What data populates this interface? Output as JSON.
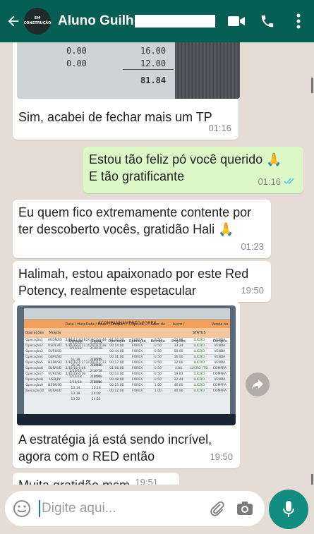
{
  "header": {
    "contact_name": "Aluno Guilh",
    "avatar_line1": "EM",
    "avatar_line2": "CONSTRUÇÃO"
  },
  "colors": {
    "header_bg": "#075e54",
    "chat_bg": "#e5ddd5",
    "outgoing_bubble": "#dcf8c6",
    "accent": "#128c7e",
    "read_ticks": "#4fc3f7"
  },
  "image1": {
    "values": [
      "0.00",
      "0.00",
      "16.00",
      "12.00",
      "81.84"
    ]
  },
  "messages": [
    {
      "text": "Sim, acabei de fechar mais um TP",
      "time": "01:16"
    },
    {
      "line1": "Estou tão feliz pó você querido 🙏",
      "line2": "E tão gratificante",
      "time": "01:16"
    },
    {
      "line1": "Eu quem fico extremamente contente por",
      "line2": "ter descoberto vocês,  gratidão Hali 🙏",
      "time": "01:23"
    },
    {
      "line1": "Halimah,  estou apaixonado por este Red",
      "line2": "Potency,  realmente espetacular",
      "time": "19:50"
    },
    {
      "line1": "A estratégia já está sendo incrível,",
      "line2": "agora com o RED então",
      "time": "19:50"
    },
    {
      "text": "Muita gratidão msm",
      "time": "19:51"
    }
  ],
  "spreadsheet": {
    "title": "ACOMPANHAMENTO FOREX",
    "headers": [
      "Operações",
      "Moeda",
      "Data / Hora Entrada",
      "Data / Hora Saída",
      "Tempo Operação",
      "Tipo de Operação",
      "Valor de Entrada",
      "Lucro / Prejuízo",
      "STATUS",
      "Venda ou Compra"
    ],
    "rows": [
      [
        "Operação1",
        "AUDNZD",
        "2/18/17 6:48",
        "2/18/17 6:49",
        "01:06:29",
        "FOREX",
        "0.50",
        "25.88",
        "LUCRO",
        "VENDA"
      ],
      [
        "Operação2",
        "USDCAD",
        "5/16/18 0:11",
        "1/10/18 0:28",
        "00:14:00",
        "FOREX",
        "0.50",
        "33.34",
        "LUCRO",
        "VENDA"
      ],
      [
        "Operação3",
        "EURUSD",
        "2/10/18 11:38",
        "2/10/18 12:24",
        "00:44:00",
        "FOREX",
        "0.50",
        "50.00",
        "LUCRO",
        "VENDA"
      ],
      [
        "Operação4",
        "GBPUSD",
        "2/10/18 15:16",
        "2/10/18 15:46",
        "00:31:00",
        "FOREX",
        "0.50",
        "16.00",
        "LUCRO",
        "VENDA"
      ],
      [
        "Operação5",
        "NZDUSD",
        "2/10/18 6:27",
        "2/10/18 1:23",
        "00:17:00",
        "FOREX",
        "0.50",
        "12.00",
        "LUCRO",
        "VENDA"
      ],
      [
        "Operação6",
        "EURAUD",
        "2/10/18 6:46",
        "2/10/18 11:01",
        "01:06:00",
        "FOREX",
        "0.50",
        "4.84",
        "LUCRO (TS)",
        "COMPRA"
      ],
      [
        "Operação7",
        "EURUSD",
        "2/10/18 6:03",
        "2/10/18 12:04",
        "00:03:00",
        "FOREX",
        "0.50",
        "19.83",
        "LUCRO",
        "COMPRA"
      ],
      [
        "Operação8",
        "USDJPY",
        "2/10/18 10:14",
        "2/10/18 10:18",
        "00:48:00",
        "FOREX",
        "0.50",
        "22.44",
        "LUCRO",
        "VENDA"
      ],
      [
        "Operação9",
        "NZDUSD",
        "2/10/18 13:18",
        "2/10/18 14:02",
        "00:23:00",
        "FOREX",
        "1.00",
        "46.00",
        "LUCRO",
        "COMPRA"
      ],
      [
        "Operação10",
        "EURAUD",
        "2/10/18 13:22",
        "2/10/18 14:22",
        "00:12:00",
        "FOREX",
        "1.00",
        "40.00",
        "LUCRO",
        "COMPRA"
      ]
    ]
  },
  "composer": {
    "placeholder": "Digite aqui..."
  }
}
